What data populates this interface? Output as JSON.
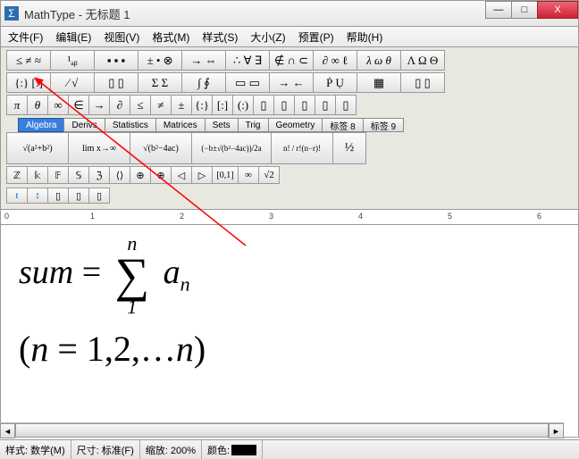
{
  "window": {
    "app_icon_glyph": "Σ",
    "title": "MathType - 无标题 1",
    "min": "—",
    "max": "□",
    "close": "X"
  },
  "menu": {
    "file": "文件(F)",
    "edit": "编辑(E)",
    "view": "视图(V)",
    "format": "格式(M)",
    "style": "样式(S)",
    "size": "大小(Z)",
    "preset": "预置(P)",
    "help": "帮助(H)"
  },
  "palettes": {
    "row1": [
      "≤ ≠ ≈",
      "¹ₐᵦ",
      "▪ ▪ ▪",
      "± • ⊗",
      "→ ⇔",
      "∴ ∀ ∃",
      "∉ ∩ ⊂",
      "∂ ∞ ℓ",
      "λ ω θ",
      "Λ Ω Θ"
    ],
    "row2": [
      "{:} [:]",
      "⁄ √",
      "▯ ▯",
      "Σ Σ",
      "∫ ∮",
      "▭ ▭",
      "→ ←",
      "Ṗ Ụ",
      "▦",
      "▯ ▯"
    ],
    "row3": [
      "π",
      "θ",
      "∞",
      "∈",
      "→",
      "∂",
      "≤",
      "≠",
      "±",
      "{:}",
      "[:]",
      "(:)",
      "▯",
      "▯",
      "▯",
      "▯",
      "▯"
    ],
    "formula_row": [
      "√(a²+b²)",
      "lim x→∞",
      "√(b²−4ac)",
      "(−b±√(b²−4ac))/2a",
      "n! / r!(n−r)!",
      "½"
    ],
    "sym_row": [
      "ℤ",
      "𝕜",
      "𝔽",
      "𝕊",
      "ℨ",
      "⟨⟩",
      "⊕",
      "⊕",
      "◁",
      "▷",
      "[0,1]",
      "∞",
      "√2"
    ]
  },
  "tabs": {
    "items": [
      "Algebra",
      "Derivs",
      "Statistics",
      "Matrices",
      "Sets",
      "Trig",
      "Geometry",
      "标签 8",
      "标签 9"
    ],
    "active_index": 0
  },
  "smallbar": [
    "t",
    "↕",
    "▯",
    "▯",
    "▯"
  ],
  "ruler": {
    "marks": [
      "0",
      "1",
      "2",
      "3",
      "4",
      "5",
      "6"
    ]
  },
  "equation": {
    "lhs": "sum",
    "eq": "=",
    "upper": "n",
    "lower": "1",
    "term_base": "a",
    "term_sub": "n",
    "line2_open": "(",
    "line2_var": "n",
    "line2_eq": "=",
    "line2_vals": "1,2,…",
    "line2_last": "n",
    "line2_close": ")"
  },
  "status": {
    "style_label": "样式: 数学(M)",
    "size_label": "尺寸: 标准(F)",
    "zoom_label": "缩放: 200%",
    "color_label": "颜色:"
  }
}
